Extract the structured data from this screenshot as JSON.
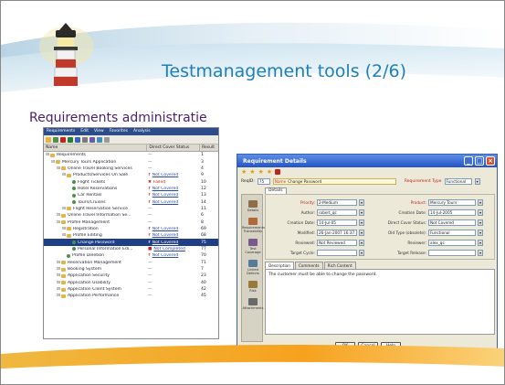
{
  "slide": {
    "title": "Testmanagement tools (2/6)",
    "subtitle": "Requirements administratie"
  },
  "tree_window": {
    "menu": [
      "Requirements",
      "Edit",
      "View",
      "Favorites",
      "Analysis"
    ],
    "columns": {
      "name": "Name",
      "status": "Direct Cover Status",
      "result": "Result"
    },
    "rows": [
      {
        "name": "Requirements",
        "status": "—",
        "result": "1",
        "indent": 0,
        "kind": "folder"
      },
      {
        "name": "Mercury Tours Application",
        "status": "—",
        "result": "3",
        "indent": 1,
        "kind": "folder"
      },
      {
        "name": "Online Travel Booking Services",
        "status": "—",
        "result": "4",
        "indent": 2,
        "kind": "folder"
      },
      {
        "name": "Products/Services On Sale",
        "status": "Not Covered",
        "result": "9",
        "indent": 3,
        "kind": "folder",
        "mark": "?"
      },
      {
        "name": "Flight Tickets",
        "status": "Failed",
        "result": "10",
        "indent": 4,
        "kind": "leaf",
        "mark": "x"
      },
      {
        "name": "Hotel Reservations",
        "status": "Not Covered",
        "result": "12",
        "indent": 4,
        "kind": "leaf",
        "mark": "?"
      },
      {
        "name": "Car Rentals",
        "status": "Not Covered",
        "result": "13",
        "indent": 4,
        "kind": "leaf",
        "mark": "?"
      },
      {
        "name": "Tours/Cruises",
        "status": "Not Covered",
        "result": "14",
        "indent": 4,
        "kind": "leaf",
        "mark": "?"
      },
      {
        "name": "Flight Reservation Service",
        "status": "—",
        "result": "11",
        "indent": 3,
        "kind": "folder"
      },
      {
        "name": "Online Travel Information Se...",
        "status": "—",
        "result": "6",
        "indent": 2,
        "kind": "folder"
      },
      {
        "name": "Profile Management",
        "status": "—",
        "result": "8",
        "indent": 2,
        "kind": "folder"
      },
      {
        "name": "Registration",
        "status": "Not Covered",
        "result": "69",
        "indent": 3,
        "kind": "folder",
        "mark": "?"
      },
      {
        "name": "Profile Editing",
        "status": "Not Covered",
        "result": "68",
        "indent": 3,
        "kind": "folder",
        "mark": "?"
      },
      {
        "name": "Change Password",
        "status": "Not Covered",
        "result": "75",
        "indent": 4,
        "kind": "leaf",
        "mark": "?",
        "selected": true
      },
      {
        "name": "Personal Information Edi...",
        "status": "Not Completed",
        "result": "77",
        "indent": 4,
        "kind": "leaf",
        "mark": "■"
      },
      {
        "name": "Profile Deletion",
        "status": "Not Covered",
        "result": "70",
        "indent": 3,
        "kind": "leaf",
        "mark": "?"
      },
      {
        "name": "Reservation Management",
        "status": "—",
        "result": "71",
        "indent": 2,
        "kind": "folder"
      },
      {
        "name": "Booking System",
        "status": "—",
        "result": "7",
        "indent": 2,
        "kind": "folder"
      },
      {
        "name": "Application Security",
        "status": "—",
        "result": "23",
        "indent": 2,
        "kind": "folder"
      },
      {
        "name": "Application Usability",
        "status": "—",
        "result": "40",
        "indent": 2,
        "kind": "folder"
      },
      {
        "name": "Application Client System",
        "status": "—",
        "result": "42",
        "indent": 2,
        "kind": "folder"
      },
      {
        "name": "Application Performance",
        "status": "—",
        "result": "45",
        "indent": 2,
        "kind": "folder"
      }
    ]
  },
  "details_window": {
    "title": "Requirement Details",
    "req_id": "75",
    "name_label": "Name",
    "name_value": "Change Password",
    "req_type_label": "Requirement Type",
    "req_type_value": "Functional",
    "details_tab": "Details",
    "sidebar": [
      "Details",
      "Requirements Traceability",
      "Test Coverage",
      "Linked Defects",
      "Risk",
      "Attachments"
    ],
    "fields_left": [
      {
        "label": "Priority",
        "value": "2-Medium",
        "red": true
      },
      {
        "label": "Author",
        "value": "robert_qc",
        "red": false
      },
      {
        "label": "Creation Date",
        "value": "14-Jul-05",
        "red": false
      },
      {
        "label": "Modified",
        "value": "26-Jan-2007 16:37:13",
        "red": false
      },
      {
        "label": "Reviewed",
        "value": "Not Reviewed",
        "red": false
      },
      {
        "label": "Target Cycle",
        "value": "",
        "red": false
      }
    ],
    "fields_right": [
      {
        "label": "Product",
        "value": "Mercury Tours",
        "red": true
      },
      {
        "label": "Creation Date",
        "value": "14-Jul-2005",
        "red": false
      },
      {
        "label": "Direct Cover Status",
        "value": "Not Covered",
        "red": false
      },
      {
        "label": "Old Type (obsolete)",
        "value": "Functional",
        "red": false
      },
      {
        "label": "Reviewer",
        "value": "alex_qc",
        "red": false
      },
      {
        "label": "Target Release",
        "value": "",
        "red": false
      }
    ],
    "desc_tabs": [
      "Description",
      "Comments",
      "Rich Content"
    ],
    "description": "The customer must be able to change the password.",
    "buttons": {
      "ok": "OK",
      "cancel": "Cancel",
      "help": "Help"
    }
  }
}
